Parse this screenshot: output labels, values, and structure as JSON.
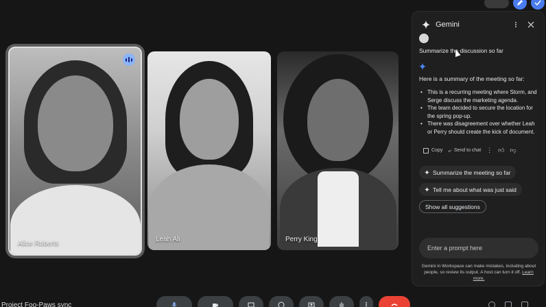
{
  "participants": [
    {
      "name": "Alice Roberts",
      "speaking": true
    },
    {
      "name": "Leah Ali",
      "speaking": false
    },
    {
      "name": "Perry King",
      "speaking": false
    }
  ],
  "meeting": {
    "name": "Project Foo-Paws sync"
  },
  "gemini": {
    "title": "Gemini",
    "user_query": "Summarize the discussion so far",
    "summary_intro": "Here is a summary of the meeting so far:",
    "bullets": [
      "This is a recurring meeting where Storm, and Serge discuss the marketing agenda.",
      "The team decided to secure the location for the spring pop-up.",
      "There was disagreement over whether Leah or Perry should create the kick of document."
    ],
    "actions": {
      "copy": "Copy",
      "send": "Send to chat"
    },
    "suggestions": [
      "Summarize the meeting so far",
      "Tell me about what was just said"
    ],
    "show_all": "Show all suggestions",
    "prompt_placeholder": "Enter a prompt here",
    "disclaimer": "Gemini in Workspace can make mistakes, including about people, so review its output. A host can turn it off.",
    "learn_more": "Learn more."
  },
  "colors": {
    "accent": "#8ab4f8",
    "leave": "#ea4335",
    "panel_bg": "#1f1f1f",
    "page_bg": "#161616"
  }
}
